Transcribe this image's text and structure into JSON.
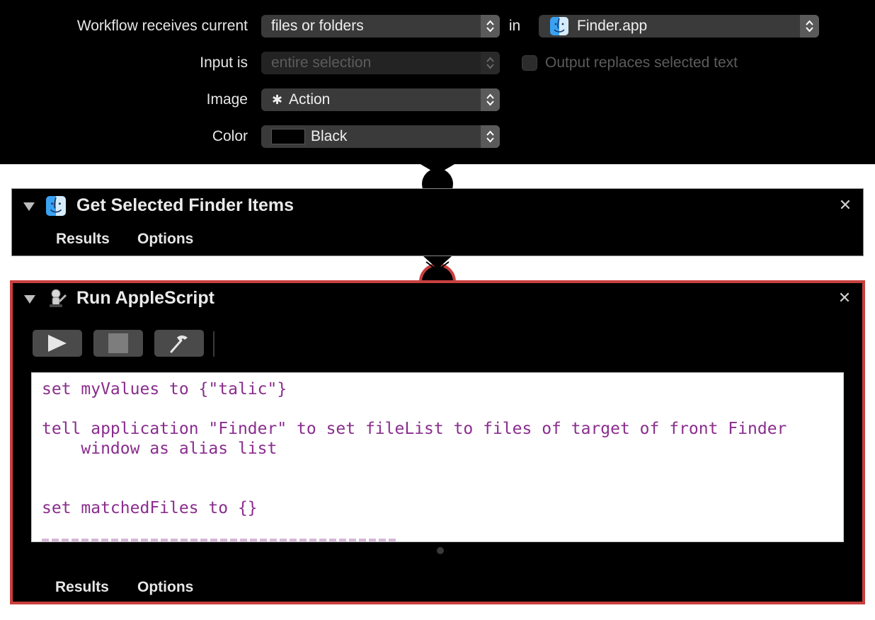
{
  "settings": {
    "workflow_label": "Workflow receives current",
    "workflow_value": "files or folders",
    "in_label": "in",
    "app_value": "Finder.app",
    "input_label": "Input is",
    "input_value": "entire selection",
    "output_replaces_label": "Output replaces selected text",
    "image_label": "Image",
    "image_value": "Action",
    "color_label": "Color",
    "color_value": "Black",
    "color_swatch": "#000000"
  },
  "actions": [
    {
      "title": "Get Selected Finder Items",
      "tabs": [
        "Results",
        "Options"
      ]
    },
    {
      "title": "Run AppleScript",
      "tabs": [
        "Results",
        "Options"
      ],
      "highlight_color": "#c9403f",
      "code": [
        "set myValues to {\"talic\"}",
        "",
        "tell application \"Finder\" to set fileList to files of target of front Finder",
        "    window as alias list",
        "",
        "",
        "set matchedFiles to {}"
      ]
    }
  ],
  "icons": {
    "finder": "finder-icon",
    "applescript": "applescript-icon",
    "gear": "gear-icon",
    "run": "play-icon",
    "stop": "stop-icon",
    "compile": "hammer-icon",
    "close": "close-icon",
    "disclosure": "disclosure-triangle-icon"
  }
}
